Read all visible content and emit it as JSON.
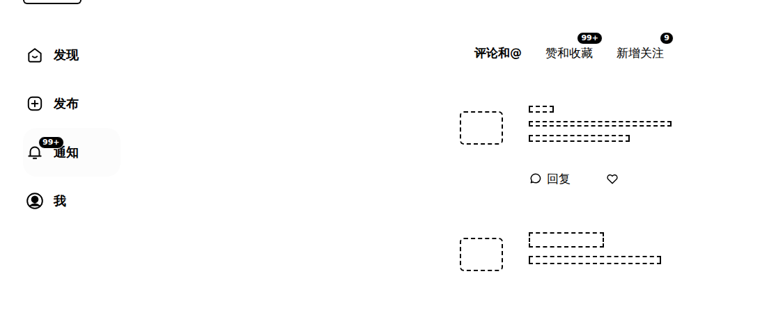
{
  "sidebar": {
    "items": [
      {
        "label": "发现",
        "selected": false
      },
      {
        "label": "发布",
        "selected": false
      },
      {
        "label": "通知",
        "selected": true,
        "badge": "99+"
      },
      {
        "label": "我",
        "selected": false
      }
    ]
  },
  "tabs": [
    {
      "label": "评论和@",
      "selected": true
    },
    {
      "label": "赞和收藏",
      "selected": false,
      "badge": "99+"
    },
    {
      "label": "新增关注",
      "selected": false,
      "badge": "9"
    }
  ],
  "notifications": [
    {
      "kind": "full",
      "reply": "回复",
      "liked": false
    },
    {
      "kind": "cut"
    }
  ]
}
